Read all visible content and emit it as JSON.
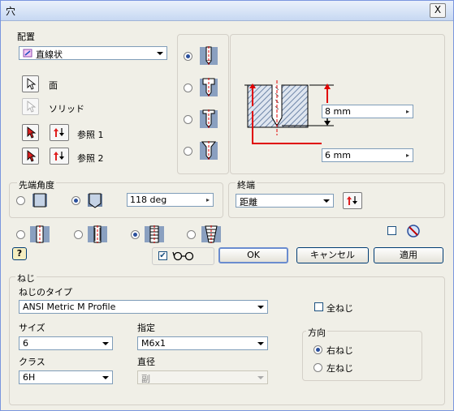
{
  "window": {
    "title": "穴",
    "close_symbol": "X"
  },
  "placement": {
    "group_label": "配置",
    "mode_value": "直線状",
    "face_label": "面",
    "solid_label": "ソリッド",
    "ref1_label": "参照 1",
    "ref2_label": "参照 2"
  },
  "hole_types": {
    "selected_index": 0,
    "options": [
      "drilled",
      "counterbore",
      "spotface",
      "countersink"
    ]
  },
  "preview": {
    "depth_value": "8 mm",
    "diameter_value": "6 mm",
    "colors": {
      "accent": "#e00000",
      "hatch": "#6f86a8"
    }
  },
  "drill_point": {
    "group_label": "先端角度",
    "selected_index": 1,
    "angle_value": "118 deg"
  },
  "termination": {
    "group_label": "終端",
    "value": "距離"
  },
  "hole_kinds": {
    "selected_index": 2,
    "options": [
      "simple",
      "clearance",
      "tapped",
      "taper-tapped"
    ]
  },
  "options": {
    "flip_checked": false,
    "preview_checked": true
  },
  "buttons": {
    "ok": "OK",
    "cancel": "キャンセル",
    "apply": "適用",
    "help": "?"
  },
  "threads": {
    "group_label": "ねじ",
    "type_label": "ねじのタイプ",
    "type_value": "ANSI Metric M Profile",
    "full_thread_label": "全ねじ",
    "full_thread_checked": false,
    "size_label": "サイズ",
    "size_value": "6",
    "designation_label": "指定",
    "designation_value": "M6x1",
    "class_label": "クラス",
    "class_value": "6H",
    "diameter_label": "直径",
    "diameter_value": "副",
    "direction": {
      "label": "方向",
      "right_label": "右ねじ",
      "left_label": "左ねじ",
      "selected": "right"
    }
  }
}
